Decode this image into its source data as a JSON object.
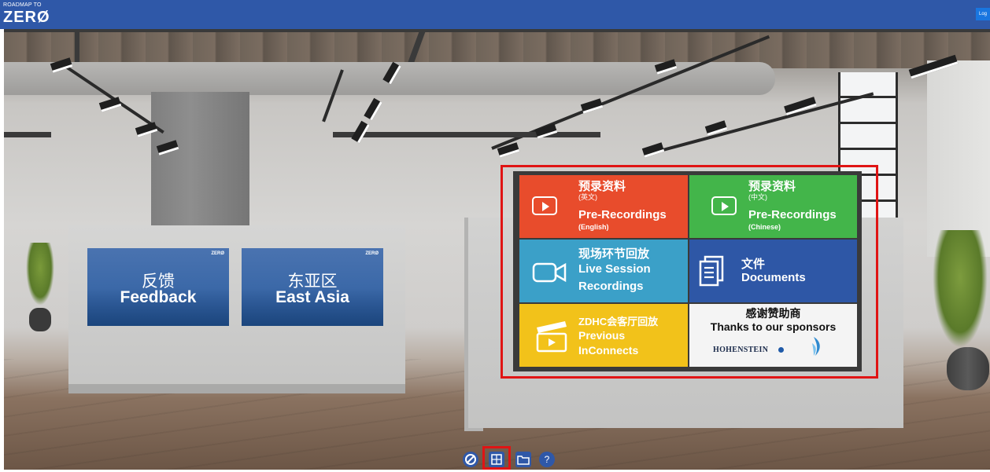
{
  "header": {
    "logo_small": "ROADMAP TO",
    "logo_big": "ZERØ",
    "login_label": "Log"
  },
  "posters": [
    {
      "brand": "ZERØ",
      "title_cn": "反馈",
      "title_en": "Feedback"
    },
    {
      "brand": "ZERØ",
      "title_cn": "东亚区",
      "title_en": "East Asia"
    }
  ],
  "board": {
    "tiles": [
      {
        "title_cn": "预录资料",
        "note": "(英文)",
        "title_en": "Pre-Recordings",
        "sub": "(English)",
        "color": "#e84c2c"
      },
      {
        "title_cn": "预录资料",
        "note": "(中文)",
        "title_en": "Pre-Recordings",
        "sub": "(Chinese)",
        "color": "#43b54a"
      },
      {
        "title_cn": "现场环节回放",
        "title_en_line1": "Live Session",
        "title_en_line2": "Recordings",
        "color": "#3ba0c8"
      },
      {
        "title_cn": "文件",
        "title_en": "Documents",
        "color": "#2e57a6"
      },
      {
        "title_cn": "ZDHC会客厅回放",
        "title_en_line1": "Previous",
        "title_en_line2": "InConnects",
        "color": "#f2c21a"
      },
      {
        "title_cn": "感谢赞助商",
        "title_en": "Thanks to our sponsors",
        "sponsor": "HOHENSTEIN",
        "color": "#f4f4f4"
      }
    ]
  },
  "toolbar": {
    "items": [
      "zero-logo-icon",
      "scene-map-icon",
      "folder-icon",
      "help-icon"
    ],
    "help_label": "?"
  }
}
